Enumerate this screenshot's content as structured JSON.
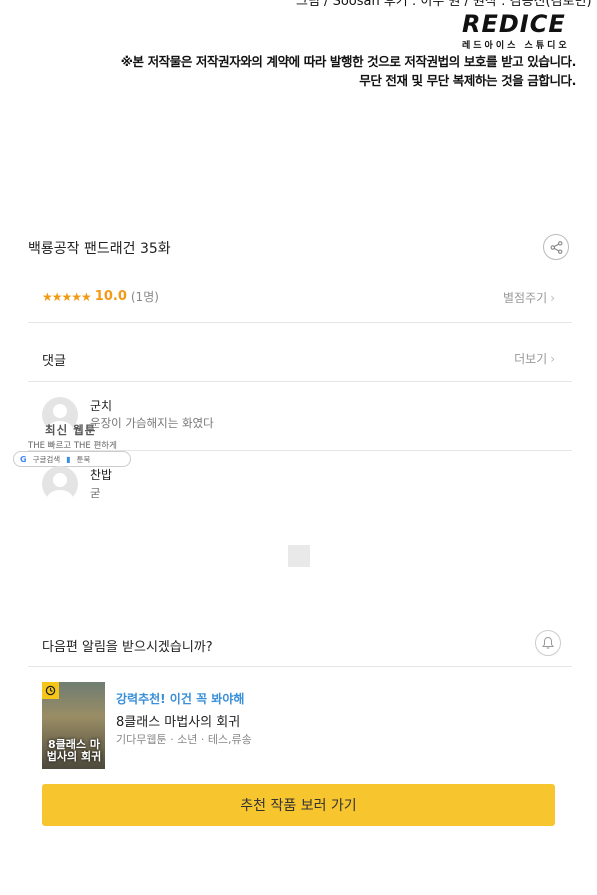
{
  "top": {
    "cut_text": "그림 / Soosan 후기 : 이수 원 / 원작 : 김용진(김로민)",
    "logo_text": "REDICE",
    "logo_sub": "레드아이스 스튜디오",
    "notice_lines": [
      "※본 저작물은 저작권자와의 계약에 따라 발행한 것으로 저작권법의 보호를 받고 있습니다.",
      "무단 전재 및 무단 복제하는 것을 금합니다."
    ]
  },
  "episode": {
    "title": "백룡공작 팬드래건 35화",
    "stars": "★★★★★",
    "score": "10.0",
    "count": "(1명)",
    "rate_link": "별점주기"
  },
  "comments": {
    "label": "댓글",
    "more": "더보기",
    "items": [
      {
        "name": "군치",
        "body": "운장이 가슴해지는 화였다"
      },
      {
        "name": "찬밥",
        "body": "굳"
      }
    ]
  },
  "watermark": {
    "title": "최신 웹툰",
    "sub": "THE 빠르고 THE 편하게",
    "google": "구글검색",
    "brand": "툰북"
  },
  "notify": {
    "label": "다음편 알림을 받으시겠습니까?"
  },
  "recommend": {
    "tag": "강력추천! 이건 꼭 봐야해",
    "title": "8클래스 마법사의 회귀",
    "meta": "기다무웹툰 · 소년 · 테스,류송",
    "thumb_title": "8클래스 마법사의 회귀",
    "cta": "추천 작품 보러 가기"
  },
  "colors": {
    "accent_yellow": "#f7c52d",
    "star_orange": "#f29a16",
    "tag_blue": "#3a8fd9"
  }
}
